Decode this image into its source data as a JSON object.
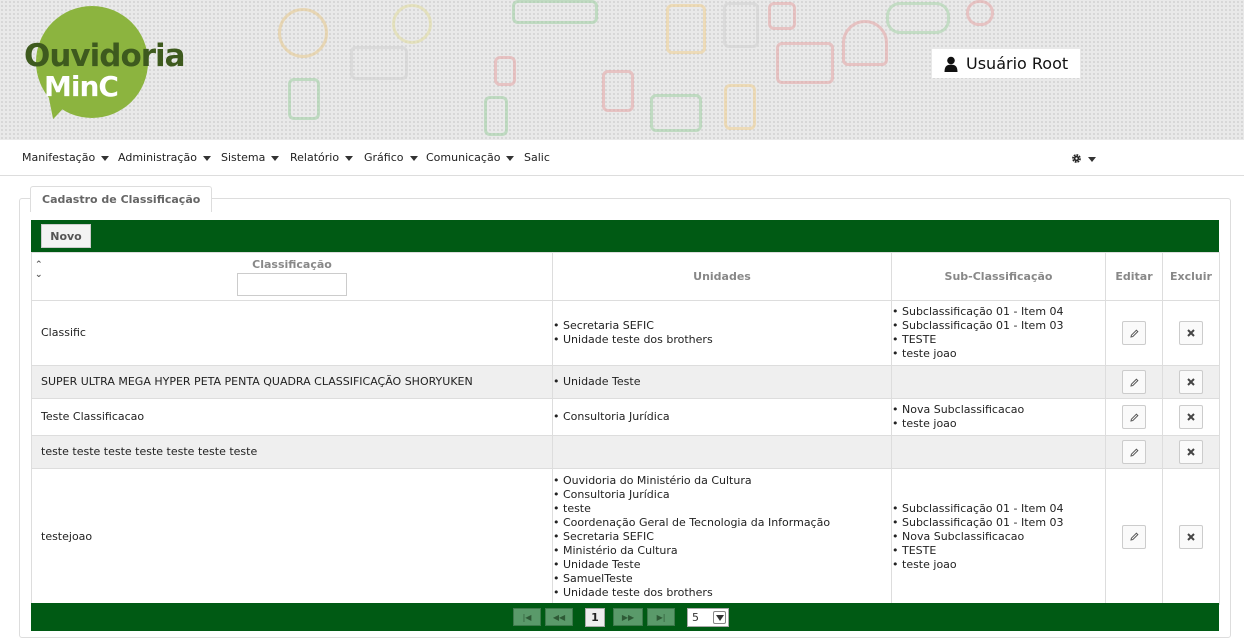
{
  "header": {
    "logo_line1": "Ouvidoria",
    "logo_line2": "MinC",
    "user_name": "Usuário Root"
  },
  "menu": [
    {
      "label": "Manifestação",
      "has_dropdown": true
    },
    {
      "label": "Administração",
      "has_dropdown": true
    },
    {
      "label": "Sistema",
      "has_dropdown": true
    },
    {
      "label": "Relatório",
      "has_dropdown": true
    },
    {
      "label": "Gráfico",
      "has_dropdown": true
    },
    {
      "label": "Comunicação",
      "has_dropdown": true
    },
    {
      "label": "Salic",
      "has_dropdown": false
    }
  ],
  "panel": {
    "title": "Cadastro de Classificação",
    "new_button": "Novo"
  },
  "table": {
    "columns": {
      "classificacao": "Classificação",
      "unidades": "Unidades",
      "sub": "Sub-Classificação",
      "editar": "Editar",
      "excluir": "Excluir"
    },
    "filter_value": "",
    "rows": [
      {
        "classificacao": "Classific",
        "unidades": [
          "Secretaria SEFIC",
          "Unidade teste dos brothers"
        ],
        "sub": [
          "Subclassificação 01 - Item 04",
          "Subclassificação 01 - Item 03",
          "TESTE",
          "teste joao"
        ]
      },
      {
        "classificacao": "SUPER ULTRA MEGA HYPER PETA PENTA QUADRA CLASSIFICAÇÃO SHORYUKEN",
        "unidades": [
          "Unidade Teste"
        ],
        "sub": []
      },
      {
        "classificacao": "Teste Classificacao",
        "unidades": [
          "Consultoria Jurídica"
        ],
        "sub": [
          "Nova Subclassificacao",
          "teste joao"
        ]
      },
      {
        "classificacao": "teste teste teste teste teste teste teste",
        "unidades": [],
        "sub": []
      },
      {
        "classificacao": "testejoao",
        "unidades": [
          "Ouvidoria do Ministério da Cultura",
          "Consultoria Jurídica",
          "teste",
          "Coordenação Geral de Tecnologia da Informação",
          "Secretaria SEFIC",
          "Ministério da Cultura",
          "Unidade Teste",
          "SamuelTeste",
          "Unidade teste dos brothers"
        ],
        "sub": [
          "Subclassificação 01 - Item 04",
          "Subclassificação 01 - Item 03",
          "Nova Subclassificacao",
          "TESTE",
          "teste joao"
        ]
      }
    ]
  },
  "pager": {
    "current_page": "1",
    "rows_per_page": "5",
    "first_icon": "first-page-icon",
    "prev_icon": "previous-page-icon",
    "next_icon": "next-page-icon",
    "last_icon": "last-page-icon"
  },
  "colors": {
    "toolbar_green": "#005a14",
    "logo_green": "#8cb43f",
    "logo_dark_green": "#3e5a1e"
  }
}
